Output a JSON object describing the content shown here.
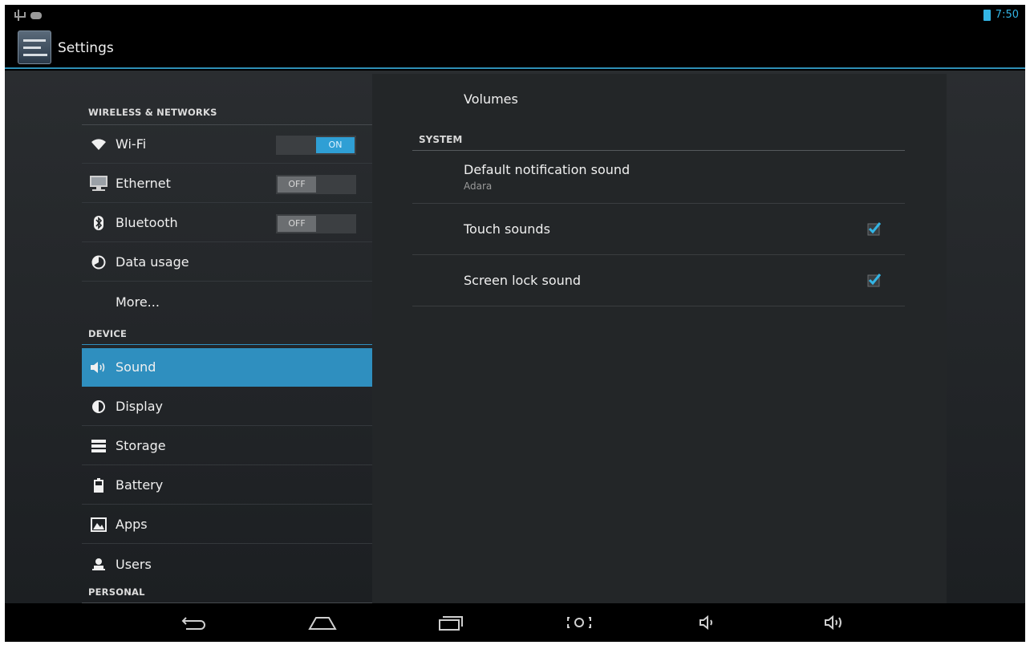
{
  "status_bar": {
    "time": "7:50"
  },
  "action_bar": {
    "title": "Settings"
  },
  "sidebar": {
    "sections": [
      {
        "header": "WIRELESS & NETWORKS"
      },
      {
        "header": "DEVICE"
      },
      {
        "header": "PERSONAL"
      }
    ],
    "items": [
      {
        "label": "Wi-Fi",
        "toggle": "ON"
      },
      {
        "label": "Ethernet",
        "toggle": "OFF"
      },
      {
        "label": "Bluetooth",
        "toggle": "OFF"
      },
      {
        "label": "Data usage"
      },
      {
        "label": "More..."
      },
      {
        "label": "Sound",
        "selected": true
      },
      {
        "label": "Display"
      },
      {
        "label": "Storage"
      },
      {
        "label": "Battery"
      },
      {
        "label": "Apps"
      },
      {
        "label": "Users"
      }
    ]
  },
  "content": {
    "volumes": "Volumes",
    "system_header": "SYSTEM",
    "default_notification": {
      "title": "Default notification sound",
      "summary": "Adara"
    },
    "touch_sounds": {
      "title": "Touch sounds",
      "checked": true
    },
    "screen_lock_sound": {
      "title": "Screen lock sound",
      "checked": true
    }
  },
  "colors": {
    "accent": "#33b5e5",
    "selected": "#2f8fbf"
  }
}
